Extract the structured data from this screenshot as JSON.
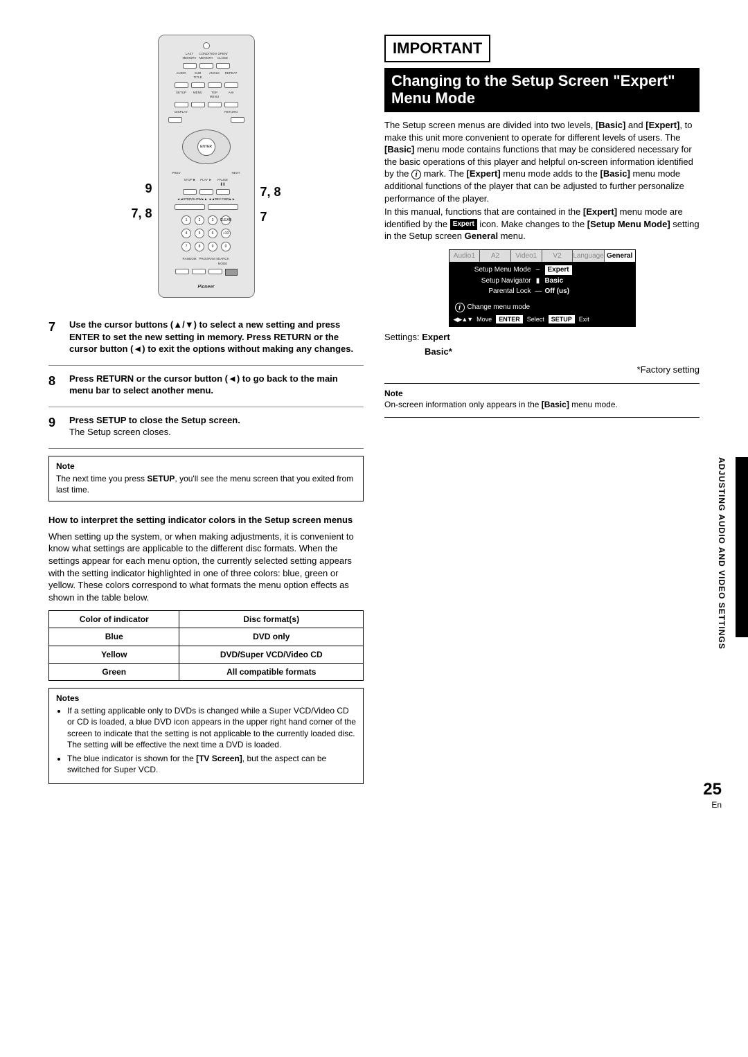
{
  "page": {
    "number": "25",
    "lang": "En",
    "side_label": "ADJUSTING AUDIO AND VIDEO SETTINGS"
  },
  "remote": {
    "callouts": {
      "left": [
        "9",
        "7, 8"
      ],
      "right": [
        "7, 8",
        "7"
      ]
    },
    "row1_labels": [
      "LAST MEMORY",
      "CONDITION MEMORY",
      "OPEN/ CLOSE"
    ],
    "row2_labels": [
      "AUDIO",
      "SUB TITLE",
      "ANGLE",
      "REPEAT"
    ],
    "row3_labels": [
      "SETUP",
      "MENU",
      "TOP MENU",
      "A-B"
    ],
    "row4_labels": [
      "DISPLAY",
      "",
      "",
      "RETURN"
    ],
    "pad_center": "ENTER",
    "pad_sides": [
      "PREV",
      "NEXT"
    ],
    "row5_labels": [
      "STOP ■",
      "PLAY ►",
      "PAUSE ❚❚"
    ],
    "row6_label": "◄◄STEP/SLOW►► ◄◄REV FWD►►",
    "num_labels": [
      "1",
      "2",
      "3",
      "CLEAR",
      "4",
      "5",
      "6",
      "+10",
      "7",
      "8",
      "9",
      "0"
    ],
    "row7_labels": [
      "RANDOM",
      "PROGRAM",
      "SEARCH MODE"
    ],
    "brand": "Pioneer"
  },
  "steps": {
    "s7": {
      "num": "7",
      "bold": "Use the cursor buttons (▲/▼) to select a new  setting and press ENTER to set the new setting in memory. Press RETURN or the cursor button (◄) to exit the options without making any changes."
    },
    "s8": {
      "num": "8",
      "bold": "Press RETURN or the cursor button (◄) to go back to the main menu bar to select another menu."
    },
    "s9": {
      "num": "9",
      "bold": "Press SETUP to close the Setup screen.",
      "text": "The Setup screen closes."
    }
  },
  "note1": {
    "title": "Note",
    "text_a": "The next time you press ",
    "bold": "SETUP",
    "text_b": ", you'll see the menu screen that you exited from last time."
  },
  "interpret": {
    "heading": "How to interpret the setting indicator colors in the Setup screen menus",
    "para": "When setting up the system, or when making adjustments, it is convenient to know what settings are applicable to the different disc formats. When the settings appear for each menu option, the currently selected setting appears with the setting indicator highlighted in one of three colors: blue, green or yellow. These colors correspond to what formats the menu option effects as shown in the table below."
  },
  "table": {
    "h1": "Color of indicator",
    "h2": "Disc format(s)",
    "rows": [
      [
        "Blue",
        "DVD only"
      ],
      [
        "Yellow",
        "DVD/Super VCD/Video CD"
      ],
      [
        "Green",
        "All compatible formats"
      ]
    ]
  },
  "notes2": {
    "title": "Notes",
    "li1": "If a setting applicable only to DVDs is changed while a Super VCD/Video CD or CD is loaded, a blue DVD icon appears in the upper right hand corner of the screen to indicate that the setting is not applicable to the currently loaded disc. The setting will be effective the next time a DVD is loaded.",
    "li2_a": "The blue indicator is shown for the ",
    "li2_b": "[TV Screen]",
    "li2_c": ", but the aspect can be switched for Super VCD."
  },
  "right": {
    "important": "IMPORTANT",
    "title": "Changing to the Setup Screen \"Expert\" Menu Mode",
    "p1_a": "The Setup screen menus are divided into two levels, ",
    "p1_b": "[Basic]",
    "p1_c": " and ",
    "p1_d": "[Expert]",
    "p1_e": ", to make this unit more convenient to operate for different levels of users. The ",
    "p1_f": "[Basic]",
    "p1_g": " menu mode contains functions that may be considered necessary for the basic operations of this player and helpful on-screen information identified by the ",
    "p1_h": " mark. The ",
    "p1_i": "[Expert]",
    "p1_j": " menu mode adds to the ",
    "p1_k": "[Basic]",
    "p1_l": " menu mode additional functions of the player that can be adjusted to further personalize performance of the player.",
    "p2_a": "In this manual, functions that are contained in the ",
    "p2_b": "[Expert]",
    "p2_c": " menu mode are identified by the ",
    "p2_icon": "Expert",
    "p2_d": " icon. Make changes to the ",
    "p2_e": "[Setup Menu Mode]",
    "p2_f": " setting in the Setup screen ",
    "p2_g": "General",
    "p2_h": " menu.",
    "osd": {
      "tabs": [
        "Audio1",
        "A2",
        "Video1",
        "V2",
        "Language",
        "General"
      ],
      "active_tab": 5,
      "rows": [
        {
          "label": "Setup Menu Mode",
          "value": "Expert",
          "selected": true
        },
        {
          "label": "Setup Navigator",
          "bullet": "▮",
          "value": "Basic"
        },
        {
          "label": "Parental Lock",
          "dash": "—",
          "value": "Off (us)"
        }
      ],
      "info": "Change menu mode",
      "foot": {
        "arrows": "◀▶▲▼",
        "move": "Move",
        "enter": "ENTER",
        "select": "Select",
        "setup": "SETUP",
        "exit": "Exit"
      }
    },
    "settings_label": "Settings: ",
    "settings_val1": "Expert",
    "settings_val2": "Basic*",
    "factory": "*Factory setting",
    "note_title": "Note",
    "note_text_a": "On-screen information only appears in the ",
    "note_text_b": "[Basic]",
    "note_text_c": " menu mode."
  }
}
